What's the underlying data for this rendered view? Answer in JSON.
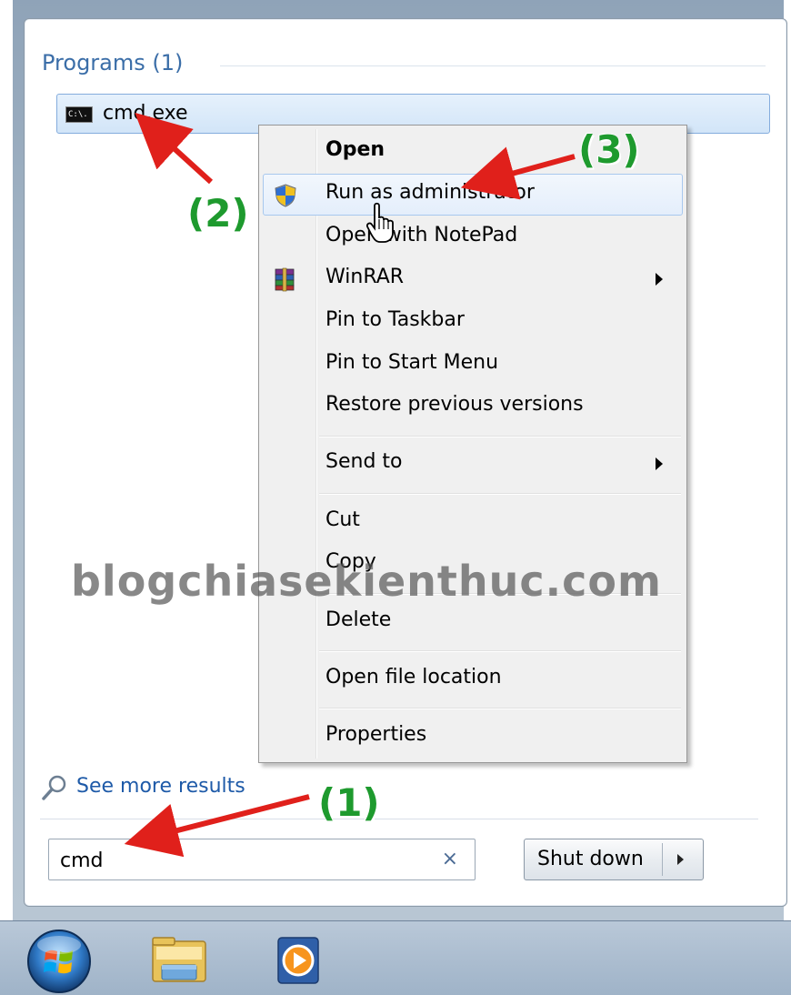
{
  "start_menu": {
    "programs_heading": "Programs (1)",
    "result": {
      "label": "cmd.exe",
      "icon": "console-icon",
      "icon_text": "C:\\."
    },
    "see_more": {
      "label": "See more results",
      "icon": "search-icon"
    },
    "search": {
      "value": "cmd",
      "clear_glyph": "×"
    },
    "shutdown_label": "Shut down"
  },
  "context_menu": {
    "items": [
      {
        "label": "Open",
        "bold": true
      },
      {
        "label": "Run as administrator",
        "icon": "uac-shield-icon",
        "highlighted": true
      },
      {
        "label": "Open with NotePad"
      },
      {
        "label": "WinRAR",
        "icon": "winrar-icon",
        "submenu": true
      },
      {
        "label": "Pin to Taskbar"
      },
      {
        "label": "Pin to Start Menu"
      },
      {
        "label": "Restore previous versions"
      },
      {
        "label": "Send to",
        "submenu": true
      },
      {
        "label": "Cut"
      },
      {
        "label": "Copy"
      },
      {
        "label": "Delete"
      },
      {
        "label": "Open file location"
      },
      {
        "label": "Properties"
      }
    ]
  },
  "annotations": {
    "step1": "(1)",
    "step2": "(2)",
    "step3": "(3)",
    "color": "#1e9a2e",
    "arrow_color": "#e0201b"
  },
  "watermark": "blogchiasekienthuc.com",
  "taskbar": {
    "items": [
      "start-orb-icon",
      "windows-explorer-icon",
      "windows-media-player-icon"
    ]
  }
}
